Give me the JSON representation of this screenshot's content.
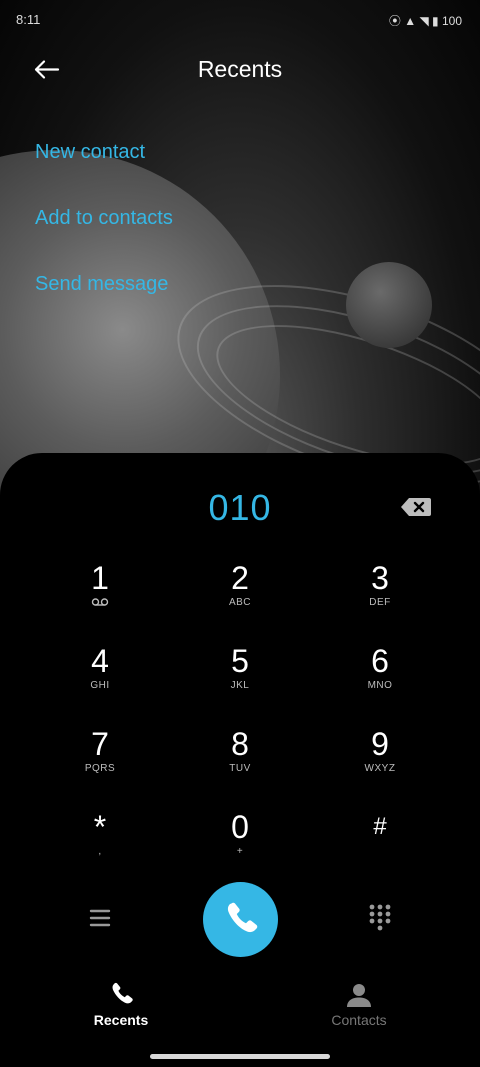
{
  "status_bar": {
    "time": "8:11",
    "right": "⦿ ▲ ◥ ▮ 100"
  },
  "header": {
    "title": "Recents",
    "back_icon": "arrow-left-icon"
  },
  "actions": [
    {
      "label": "New contact"
    },
    {
      "label": "Add to contacts"
    },
    {
      "label": "Send message"
    }
  ],
  "dialer": {
    "number": "010",
    "backspace_icon": "backspace-icon",
    "keys": [
      {
        "digit": "1",
        "letters": ""
      },
      {
        "digit": "2",
        "letters": "ABC"
      },
      {
        "digit": "3",
        "letters": "DEF"
      },
      {
        "digit": "4",
        "letters": "GHI"
      },
      {
        "digit": "5",
        "letters": "JKL"
      },
      {
        "digit": "6",
        "letters": "MNO"
      },
      {
        "digit": "7",
        "letters": "PQRS"
      },
      {
        "digit": "8",
        "letters": "TUV"
      },
      {
        "digit": "9",
        "letters": "WXYZ"
      },
      {
        "digit": "*",
        "letters": ","
      },
      {
        "digit": "0",
        "letters": "+"
      },
      {
        "digit": "#",
        "letters": ""
      }
    ],
    "menu_icon": "menu-icon",
    "call_icon": "phone-icon",
    "keypad_icon": "dialpad-icon"
  },
  "bottom_nav": {
    "recents": {
      "label": "Recents",
      "icon": "phone-icon"
    },
    "contacts": {
      "label": "Contacts",
      "icon": "person-icon"
    }
  },
  "colors": {
    "accent": "#35b7e5",
    "background": "#000000"
  }
}
